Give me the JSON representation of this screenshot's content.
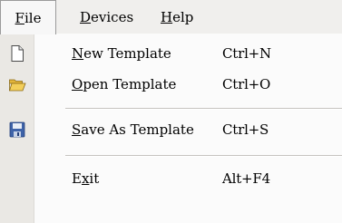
{
  "menubar": {
    "file": {
      "pre": "",
      "ul": "F",
      "post": "ile"
    },
    "devices": {
      "pre": "",
      "ul": "D",
      "post": "evices"
    },
    "help": {
      "pre": "",
      "ul": "H",
      "post": "elp"
    }
  },
  "file_menu": {
    "items": [
      {
        "pre": "",
        "ul": "N",
        "post": "ew Template",
        "shortcut": "Ctrl+N",
        "icon": "new-document-icon"
      },
      {
        "pre": "",
        "ul": "O",
        "post": "pen Template",
        "shortcut": "Ctrl+O",
        "icon": "open-folder-icon"
      },
      {
        "pre": "",
        "ul": "S",
        "post": "ave As Template",
        "shortcut": "Ctrl+S",
        "icon": "save-floppy-icon"
      },
      {
        "pre": "E",
        "ul": "x",
        "post": "it",
        "shortcut": "Alt+F4",
        "icon": ""
      }
    ]
  },
  "colors": {
    "menubar_bg": "#f0efed",
    "dropdown_bg": "#fbfbfb",
    "icon_column_bg": "#eae8e4",
    "separator": "#c6c4c0"
  }
}
